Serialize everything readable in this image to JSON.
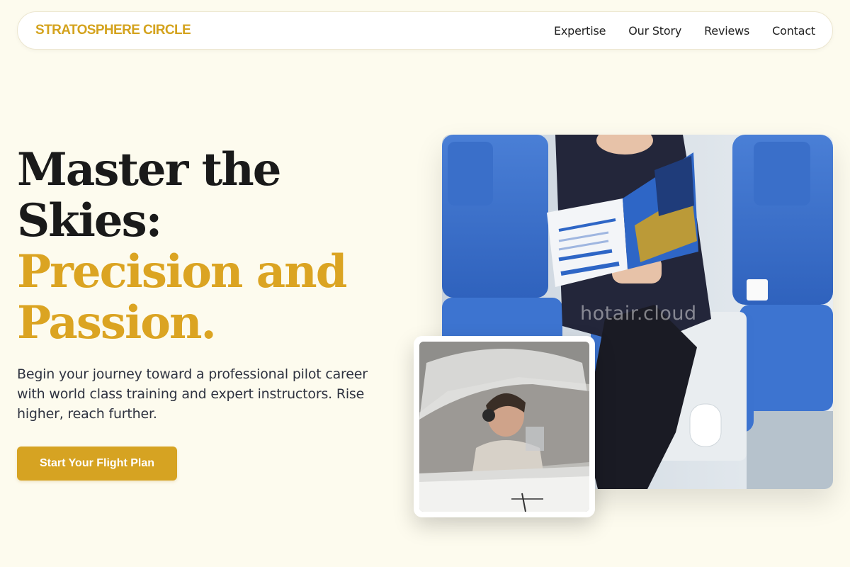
{
  "nav": {
    "brand": "STRATOSPHERE CIRCLE",
    "links": [
      "Expertise",
      "Our Story",
      "Reviews",
      "Contact"
    ]
  },
  "hero": {
    "headline_dark_1": "Master the",
    "headline_dark_2": "Skies:",
    "headline_gold_1": "Precision and",
    "headline_gold_2": "Passion.",
    "subtitle": "Begin your journey toward a professional pilot career with world class training and expert instructors. Rise higher, reach further.",
    "cta_label": "Start Your Flight Plan"
  },
  "images": {
    "main": "woman reading aviation brochure in cabin seats",
    "inset": "pilot wearing headset in small aircraft cockpit",
    "watermark": "hotair.cloud"
  },
  "colors": {
    "background": "#fdfbee",
    "accent": "#d6a322",
    "headline": "#1a1a1a"
  }
}
